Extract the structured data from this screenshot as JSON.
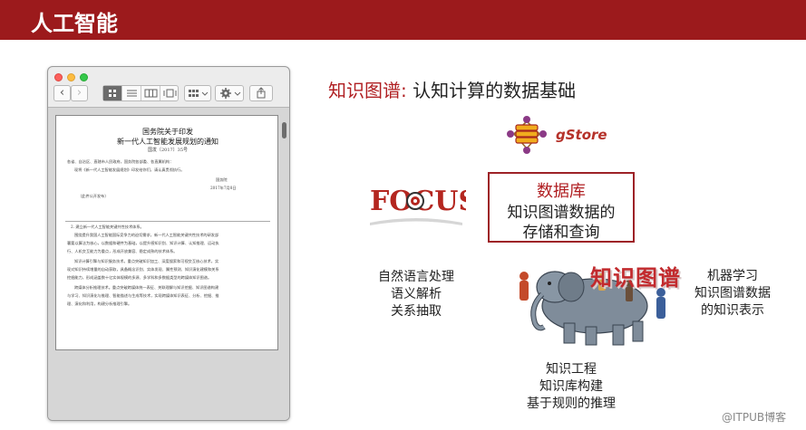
{
  "header": {
    "title": "人工智能"
  },
  "document": {
    "title_line1": "国务院关于印发",
    "title_line2": "新一代人工智能发展规划的通知",
    "doc_number": "国发〔2017〕35号",
    "recipients": "各省、自治区、直辖市人民政府，国务院各部委、各直属机构：",
    "body_line1": "现将《新一代人工智能发展规划》印发给你们，请认真贯彻执行。",
    "signer": "国务院",
    "date": "2017年7月8日",
    "publication_note": "（此件公开发布）",
    "section_heading": "2. 建立新一代人工智能关键共性技术体系。",
    "para1_a": "围绕提升我国人工智能国际竞争力的迫切需求，新一代人工智能关键共性技术的研发部",
    "para1_b": "署要以算法为核心，以数据和硬件为基础，以提升感知识别、知识计算、认知推理、运动执",
    "para1_c": "行、人机交互能力为重点，形成开放兼容、稳定成熟的技术体系。",
    "para2_a": "知识计算引擎与知识服务技术。重点突破知识加工、深度搜索和可视交互核心技术，实",
    "para2_b": "现对知识持续增量的自动获取，具备概念识别、实体发现、属性预测、知识演化建模和关系",
    "para2_c": "挖掘能力，形成涵盖数十亿实体规模的多源、多学科和多数据类型的跨媒体知识图谱。",
    "para3_a": "跨媒体分析推理技术。重点突破跨媒体统一表征、关联理解与知识挖掘、知识图谱构建",
    "para3_b": "与学习、知识演化与推理、智能描述与生成等技术，实现跨媒体知识表征、分析、挖掘、推",
    "para3_c": "理、演化和利用，构建分析推理引擎。"
  },
  "main": {
    "heading_accent": "知识图谱",
    "heading_colon": ": ",
    "heading_rest": "认知计算的数据基础"
  },
  "gstore": {
    "word": "gStore"
  },
  "focus_logo": {
    "word": "FOCUS"
  },
  "database_box": {
    "line1": "数据库",
    "line2": "知识图谱数据的",
    "line3": "存储和查询"
  },
  "nlp": {
    "line1": "自然语言处理",
    "line2": "语义解析",
    "line3": "关系抽取"
  },
  "ml": {
    "line1": "机器学习",
    "line2": "知识图谱数据",
    "line3": "的知识表示"
  },
  "engineering": {
    "line1": "知识工程",
    "line2": "知识库构建",
    "line3": "基于规则的推理"
  },
  "kg_label": "知识图谱",
  "watermark": "@ITPUB博客",
  "colors": {
    "header_bg": "#9c1a1c",
    "accent_red": "#b01f22",
    "box_border": "#9d2227"
  },
  "icons": [
    "nav-back-icon",
    "nav-forward-icon",
    "icon-view-icon",
    "list-view-icon",
    "column-view-icon",
    "gallery-view-icon",
    "arrange-icon",
    "gear-icon",
    "share-icon"
  ]
}
